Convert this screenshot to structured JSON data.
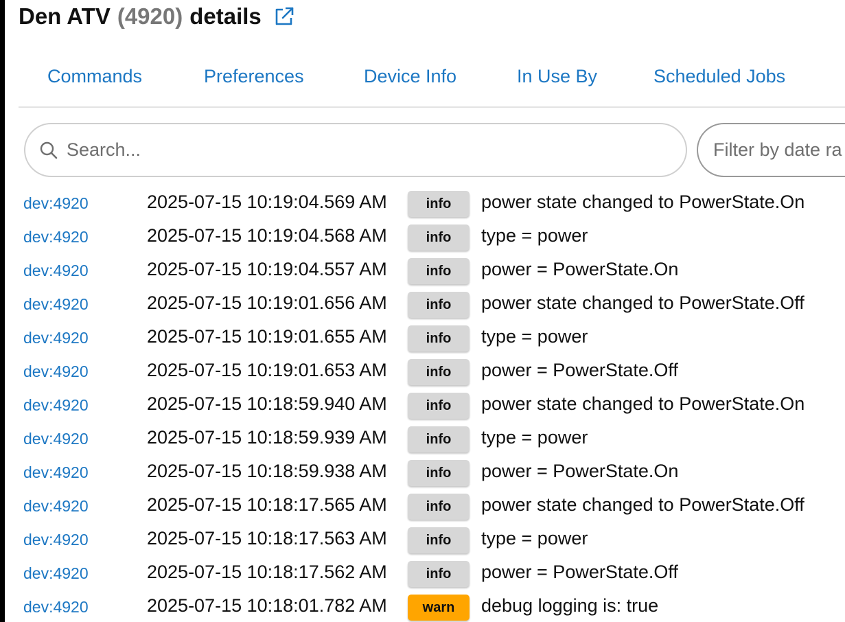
{
  "header": {
    "device_name": "Den ATV",
    "device_id": "(4920)",
    "suffix": "details"
  },
  "tabs": [
    {
      "label": "Commands"
    },
    {
      "label": "Preferences"
    },
    {
      "label": "Device Info"
    },
    {
      "label": "In Use By"
    },
    {
      "label": "Scheduled Jobs"
    }
  ],
  "search": {
    "placeholder": "Search...",
    "value": ""
  },
  "date_filter": {
    "placeholder": "Filter by date ra"
  },
  "colors": {
    "link": "#1c77c3",
    "info_badge": "#d7d7d7",
    "warn_badge": "#ffa500"
  },
  "log": [
    {
      "source": "dev:4920",
      "time": "2025-07-15 10:19:04.569 AM",
      "level": "info",
      "message": "power state changed to PowerState.On"
    },
    {
      "source": "dev:4920",
      "time": "2025-07-15 10:19:04.568 AM",
      "level": "info",
      "message": "type = power"
    },
    {
      "source": "dev:4920",
      "time": "2025-07-15 10:19:04.557 AM",
      "level": "info",
      "message": "power = PowerState.On"
    },
    {
      "source": "dev:4920",
      "time": "2025-07-15 10:19:01.656 AM",
      "level": "info",
      "message": "power state changed to PowerState.Off"
    },
    {
      "source": "dev:4920",
      "time": "2025-07-15 10:19:01.655 AM",
      "level": "info",
      "message": "type = power"
    },
    {
      "source": "dev:4920",
      "time": "2025-07-15 10:19:01.653 AM",
      "level": "info",
      "message": "power = PowerState.Off"
    },
    {
      "source": "dev:4920",
      "time": "2025-07-15 10:18:59.940 AM",
      "level": "info",
      "message": "power state changed to PowerState.On"
    },
    {
      "source": "dev:4920",
      "time": "2025-07-15 10:18:59.939 AM",
      "level": "info",
      "message": "type = power"
    },
    {
      "source": "dev:4920",
      "time": "2025-07-15 10:18:59.938 AM",
      "level": "info",
      "message": "power = PowerState.On"
    },
    {
      "source": "dev:4920",
      "time": "2025-07-15 10:18:17.565 AM",
      "level": "info",
      "message": "power state changed to PowerState.Off"
    },
    {
      "source": "dev:4920",
      "time": "2025-07-15 10:18:17.563 AM",
      "level": "info",
      "message": "type = power"
    },
    {
      "source": "dev:4920",
      "time": "2025-07-15 10:18:17.562 AM",
      "level": "info",
      "message": "power = PowerState.Off"
    },
    {
      "source": "dev:4920",
      "time": "2025-07-15 10:18:01.782 AM",
      "level": "warn",
      "message": "debug logging is: true"
    }
  ]
}
